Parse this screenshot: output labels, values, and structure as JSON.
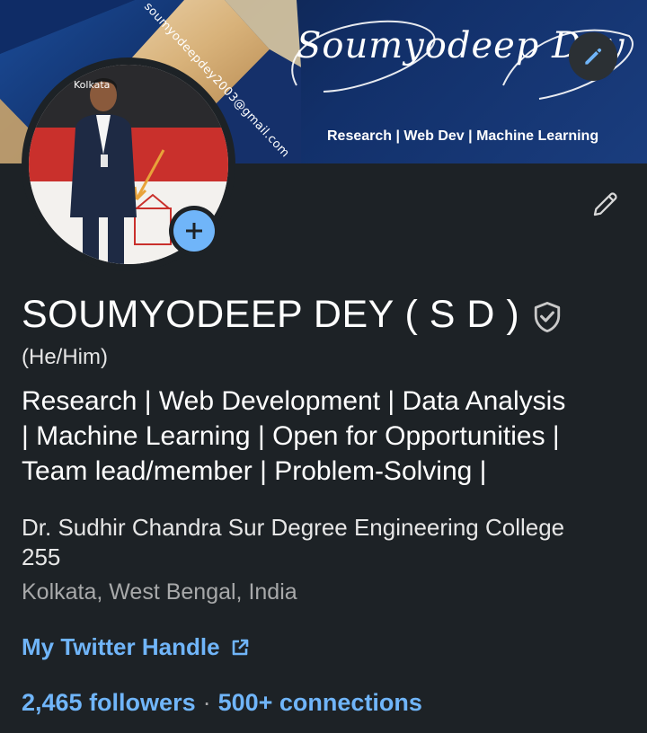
{
  "banner": {
    "email": "soumyodeepdey2003@gmail.com",
    "signature": "Soumyodeep Dey",
    "tagline": "Research | Web Dev | Machine Learning",
    "edit_icon": "pencil-icon"
  },
  "avatar": {
    "city_sign": "Kolkata",
    "add_icon": "plus-icon"
  },
  "profile": {
    "edit_icon": "pencil-icon",
    "name": "SOUMYODEEP DEY ( S D )",
    "verified_icon": "shield-check-icon",
    "pronouns": "(He/Him)",
    "headline_line1": "Research | Web Development | Data Analysis",
    "headline_line2": "| Machine Learning | Open for Opportunities |",
    "headline_line3": "Team lead/member | Problem-Solving |",
    "college_line1": "Dr. Sudhir Chandra Sur Degree Engineering College",
    "college_line2": "255",
    "location": "Kolkata, West Bengal, India",
    "link_label": "My Twitter Handle",
    "link_icon": "external-link-icon",
    "followers": "2,465 followers",
    "separator": "·",
    "connections": "500+ connections"
  },
  "colors": {
    "background": "#1d2226",
    "link": "#70b5f9",
    "banner_navy": "#12306a",
    "banner_gold": "#c9a36a"
  }
}
